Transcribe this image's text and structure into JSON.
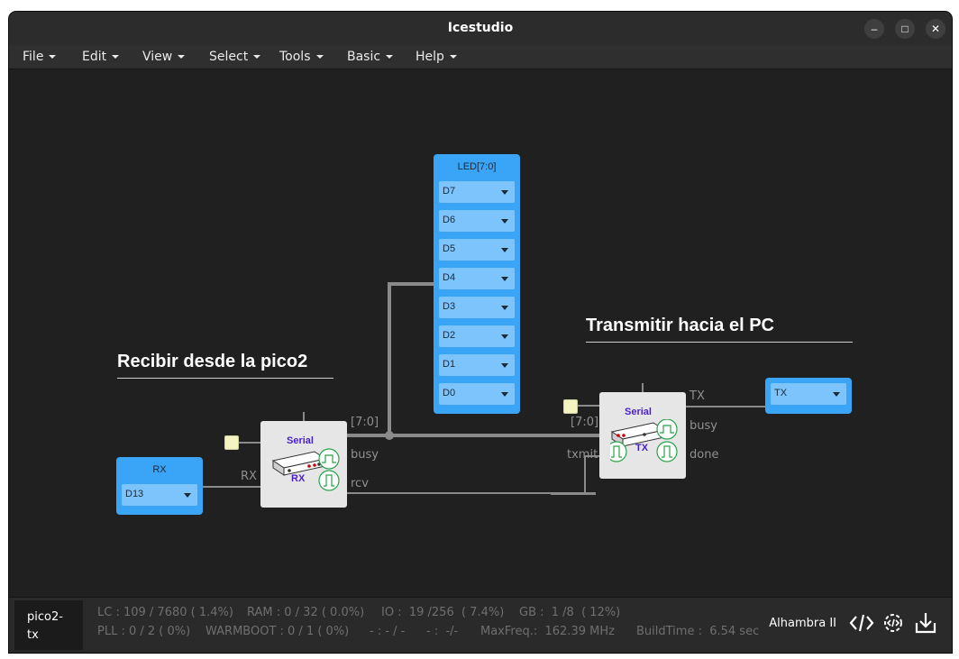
{
  "window": {
    "title": "Icestudio",
    "controls": {
      "minimize": "–",
      "maximize": "□",
      "close": "✕"
    }
  },
  "menu": [
    {
      "label": "File"
    },
    {
      "label": "Edit"
    },
    {
      "label": "View"
    },
    {
      "label": "Select"
    },
    {
      "label": "Tools"
    },
    {
      "label": "Basic"
    },
    {
      "label": "Help"
    }
  ],
  "canvas": {
    "heading_receive": "Recibir desde la pico2",
    "heading_transmit": "Transmitir hacia el PC",
    "led_block": {
      "title": "LED[7:0]",
      "pins": [
        "D7",
        "D6",
        "D5",
        "D4",
        "D3",
        "D2",
        "D1",
        "D0"
      ]
    },
    "rx_block": {
      "title": "RX",
      "pin": "D13"
    },
    "tx_block": {
      "pin": "TX"
    },
    "serial_rx": {
      "title": "Serial",
      "subtitle": "RX",
      "ports": {
        "in": "RX",
        "out_data": "[7:0]",
        "out_busy": "busy",
        "out_rcv": "rcv"
      }
    },
    "serial_tx": {
      "title": "Serial",
      "subtitle": "TX",
      "ports": {
        "in_data": "[7:0]",
        "in_txmit": "txmit",
        "out_tx": "TX",
        "out_busy": "busy",
        "out_done": "done"
      }
    }
  },
  "statusbar": {
    "tab": "pico2-tx",
    "lc": "LC : 109 / 7680 ( 1.4%)",
    "ram": "RAM : 0 / 32 ( 0.0%)",
    "io": "IO :  19 /256  ( 7.4%)",
    "gb": "GB :  1 /8  ( 12%)",
    "pll": "PLL : 0 / 2 ( 0%)",
    "warmboot": "WARMBOOT : 0 / 1 ( 0%)",
    "dash1": "- : - / -",
    "dash2": "- :  -/-",
    "maxfreq": "MaxFreq.:  162.39 MHz",
    "buildtime": "BuildTime :  6.54 sec",
    "board": "Alhambra II"
  },
  "colors": {
    "background": "#202020",
    "io_block": "#3aa4f6",
    "io_pin": "#7cc4fb",
    "module": "#e6e6e6",
    "wire": "#8a8a8a",
    "bus": "#8a8a8a",
    "module_label": "#4b1fcf"
  }
}
